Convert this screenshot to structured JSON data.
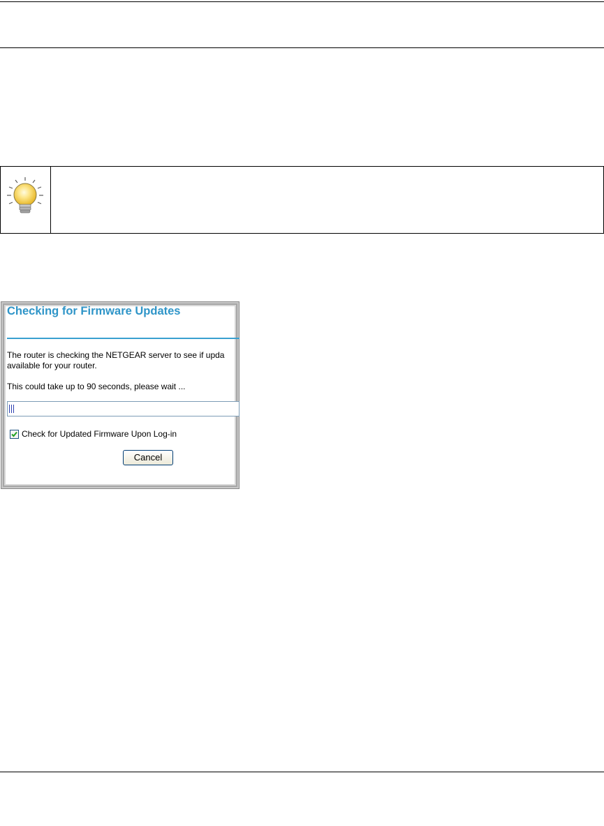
{
  "dialog": {
    "title": "Checking for Firmware Updates",
    "message_line1": "The router is checking the NETGEAR server to see if upda",
    "message_line2": "available for your router.",
    "wait_text": "This could take up to 90 seconds, please wait ...",
    "progress": 0.02,
    "checkbox_label": "Check for Updated Firmware Upon Log-in",
    "checkbox_checked": true,
    "cancel_label": "Cancel"
  },
  "colors": {
    "title": "#2f95c8",
    "rule": "#3aa0d0",
    "progress_fill": "#2c3fb0",
    "bulb": "#f7d44a"
  },
  "icons": {
    "tip": "lightbulb-icon",
    "check": "checkmark-icon"
  }
}
